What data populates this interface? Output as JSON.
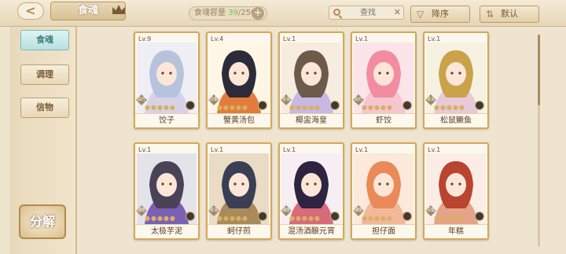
{
  "header": {
    "back_icon": "back-arrow-icon",
    "title": "食魂",
    "title_icon": "crown-icon",
    "capacity_label": "食魂容量",
    "capacity_current": "39",
    "capacity_max": "/250",
    "capacity_plus": "+",
    "search_placeholder": "查找",
    "search_close": "✕",
    "sort_desc_label": "降序",
    "sort_default_label": "默认"
  },
  "sidebar": {
    "items": [
      {
        "label": "食魂",
        "active": true
      },
      {
        "label": "调理",
        "active": false
      },
      {
        "label": "信物",
        "active": false
      }
    ],
    "decompose_label": "分解"
  },
  "cards": [
    {
      "level": "Lv.9",
      "name": "饺子",
      "badge": "治疗",
      "palette": [
        "#f0eef5",
        "#b7c3dd",
        "#d9d2e6"
      ]
    },
    {
      "level": "Lv.4",
      "name": "蟹黄汤包",
      "badge": "防御",
      "palette": [
        "#fff6e6",
        "#2b2b3a",
        "#e37b3c"
      ]
    },
    {
      "level": "Lv.1",
      "name": "椰盅海皇",
      "badge": "攻击",
      "palette": [
        "#f6ece0",
        "#6d5a4b",
        "#c9b7e4"
      ]
    },
    {
      "level": "Lv.1",
      "name": "虾饺",
      "badge": "治疗",
      "palette": [
        "#fbe4ea",
        "#f28da1",
        "#f6c6d0"
      ]
    },
    {
      "level": "Lv.1",
      "name": "松鼠鳜鱼",
      "badge": "攻击",
      "palette": [
        "#f7f1e2",
        "#c9a24a",
        "#e7c9d8"
      ]
    },
    {
      "level": "Lv.1",
      "name": "太极芋泥",
      "badge": "辅助",
      "palette": [
        "#e5e3ea",
        "#4a4358",
        "#7c60b3"
      ]
    },
    {
      "level": "Lv.1",
      "name": "蚵仔煎",
      "badge": "攻击",
      "palette": [
        "#eadbc4",
        "#3a3f54",
        "#a98a5b"
      ]
    },
    {
      "level": "Lv.1",
      "name": "混汤酒酿元宵",
      "badge": "辅助",
      "palette": [
        "#f6eef2",
        "#2e2340",
        "#d86a7a"
      ]
    },
    {
      "level": "Lv.1",
      "name": "担仔面",
      "badge": "辅助",
      "palette": [
        "#fbe9dc",
        "#e98a58",
        "#f3b89a"
      ]
    },
    {
      "level": "Lv.1",
      "name": "年糕",
      "badge": "防御",
      "palette": [
        "#fbede6",
        "#b9442f",
        "#e5a38a"
      ]
    }
  ]
}
